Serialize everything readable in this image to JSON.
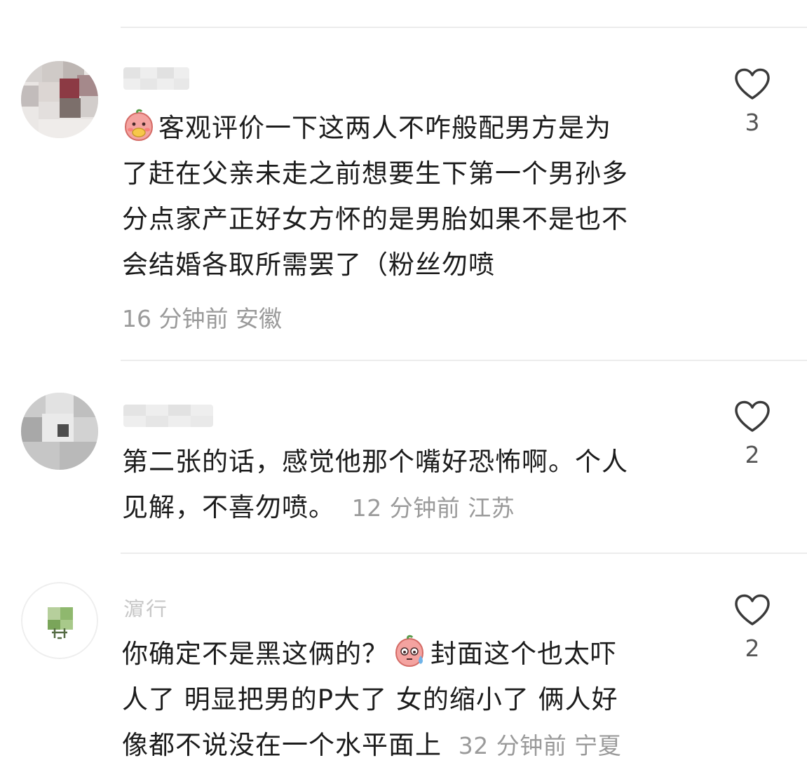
{
  "comments": [
    {
      "username": "",
      "emoji": "peach-eating-emoji",
      "text": "客观评价一下这两人不咋般配男方是为了赶在父亲未走之前想要生下第一个男孙多分点家产正好女方怀的是男胎如果不是也不会结婚各取所需罢了（粉丝勿喷",
      "lines": [
        "客观评价一下这两人不咋般配男方是为",
        "了赶在父亲未走之前想要生下第一个男孙多",
        "分点家产正好女方怀的是男胎如果不是也不",
        "会结婚各取所需罢了（粉丝勿喷"
      ],
      "time": "16 分钟前",
      "location": "安徽",
      "likes": "3"
    },
    {
      "username": "",
      "text_lines": [
        "第二张的话，感觉他那个嘴好恐怖啊。个人",
        "见解，不喜勿喷。"
      ],
      "time": "12 分钟前",
      "location": "江苏",
      "likes": "2"
    },
    {
      "username": "濵行",
      "emoji": "sweat-emoji",
      "line1_before": "你确定不是黑这俩的？",
      "line1_after": "封面这个也太吓",
      "line2": "人了 明显把男的P大了 女的缩小了 俩人好",
      "line3": "像都不说没在一个水平面上",
      "time": "32 分钟前",
      "location": "宁夏",
      "likes": "2"
    }
  ],
  "colors": {
    "text": "#1c1c1c",
    "meta": "#9a9a9a",
    "divider": "#ececec",
    "heart": "#3a3a3a"
  }
}
